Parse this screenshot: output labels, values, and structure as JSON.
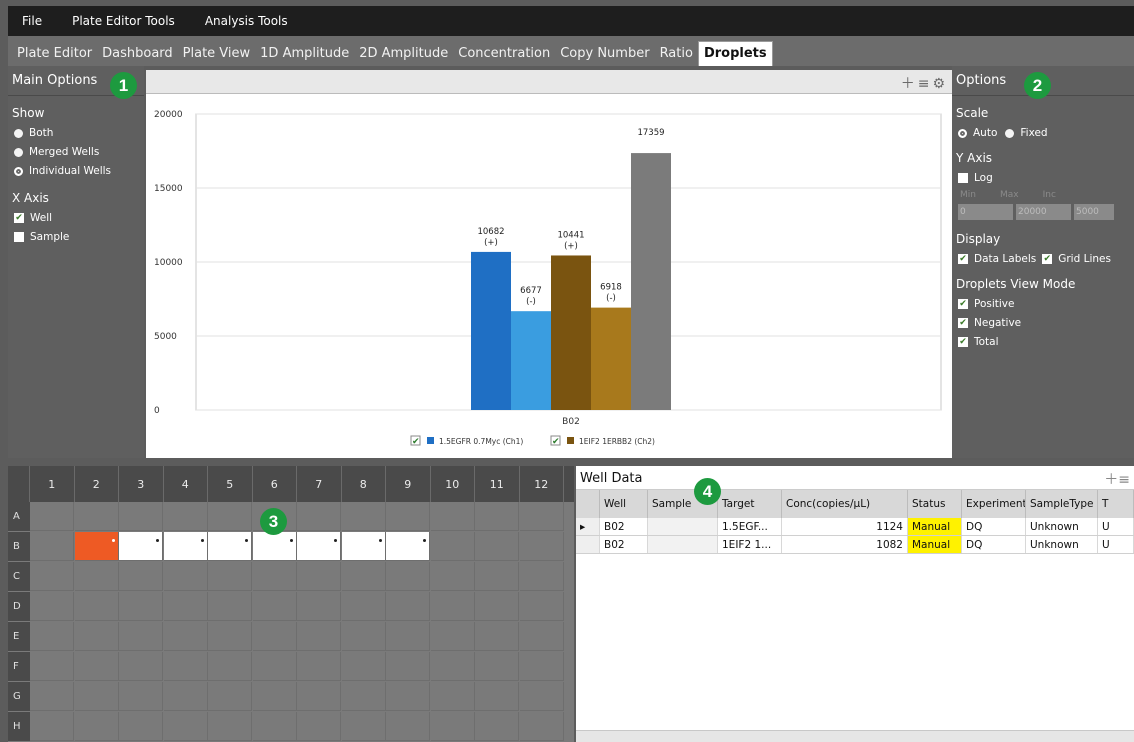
{
  "menu": [
    "File",
    "Plate Editor Tools",
    "Analysis Tools"
  ],
  "tabs": [
    "Plate Editor",
    "Dashboard",
    "Plate View",
    "1D Amplitude",
    "2D Amplitude",
    "Concentration",
    "Copy Number",
    "Ratio",
    "Droplets"
  ],
  "active_tab": "Droplets",
  "callouts": [
    "1",
    "2",
    "3",
    "4"
  ],
  "main_options": {
    "title": "Main Options",
    "show_label": "Show",
    "show_options": [
      "Both",
      "Merged Wells",
      "Individual Wells"
    ],
    "show_selected": "Individual Wells",
    "xaxis_label": "X Axis",
    "xaxis_options": [
      {
        "label": "Well",
        "checked": true
      },
      {
        "label": "Sample",
        "checked": false
      }
    ]
  },
  "options": {
    "title": "Options",
    "scale_label": "Scale",
    "scale_auto": "Auto",
    "scale_fixed": "Fixed",
    "yaxis_label": "Y Axis",
    "log_label": "Log",
    "min_label": "Min",
    "max_label": "Max",
    "inc_label": "Inc",
    "min_value": "0",
    "max_value": "20000",
    "inc_value": "5000",
    "display_label": "Display",
    "data_labels": "Data Labels",
    "grid_lines": "Grid Lines",
    "view_mode_label": "Droplets View Mode",
    "view_modes": [
      "Positive",
      "Negative",
      "Total"
    ]
  },
  "chart_data": {
    "type": "bar",
    "categories": [
      "B02"
    ],
    "ylim": [
      0,
      20000
    ],
    "yticks": [
      "0",
      "5000",
      "10000",
      "15000",
      "20000"
    ],
    "bars": [
      {
        "value": 10682,
        "label": "10682",
        "sub": "(+)",
        "color": "#1f6fc4"
      },
      {
        "value": 6677,
        "label": "6677",
        "sub": "(-)",
        "color": "#3a9de0"
      },
      {
        "value": 10441,
        "label": "10441",
        "sub": "(+)",
        "color": "#7a5410"
      },
      {
        "value": 6918,
        "label": "6918",
        "sub": "(-)",
        "color": "#a8791c"
      },
      {
        "value": 17359,
        "label": "17359",
        "sub": "",
        "color": "#7b7b7b"
      }
    ],
    "legend": [
      {
        "name": "1.5EGFR 0.7Myc (Ch1)",
        "color": "#1f6fc4"
      },
      {
        "name": "1EIF2 1ERBB2 (Ch2)",
        "color": "#7a5410"
      }
    ]
  },
  "plate": {
    "columns": [
      "1",
      "2",
      "3",
      "4",
      "5",
      "6",
      "7",
      "8",
      "9",
      "10",
      "11",
      "12"
    ],
    "rows": [
      "A",
      "B",
      "C",
      "D",
      "E",
      "F",
      "G",
      "H"
    ]
  },
  "well_data": {
    "title": "Well Data",
    "headers": [
      "Well",
      "Sample",
      "Target",
      "Conc(copies/µL)",
      "Status",
      "Experiment",
      "SampleType",
      "T"
    ],
    "rows": [
      [
        "B02",
        "",
        "1.5EGF...",
        "1124",
        "Manual",
        "DQ",
        "Unknown",
        "U"
      ],
      [
        "B02",
        "",
        "1EIF2 1...",
        "1082",
        "Manual",
        "DQ",
        "Unknown",
        "U"
      ]
    ]
  }
}
